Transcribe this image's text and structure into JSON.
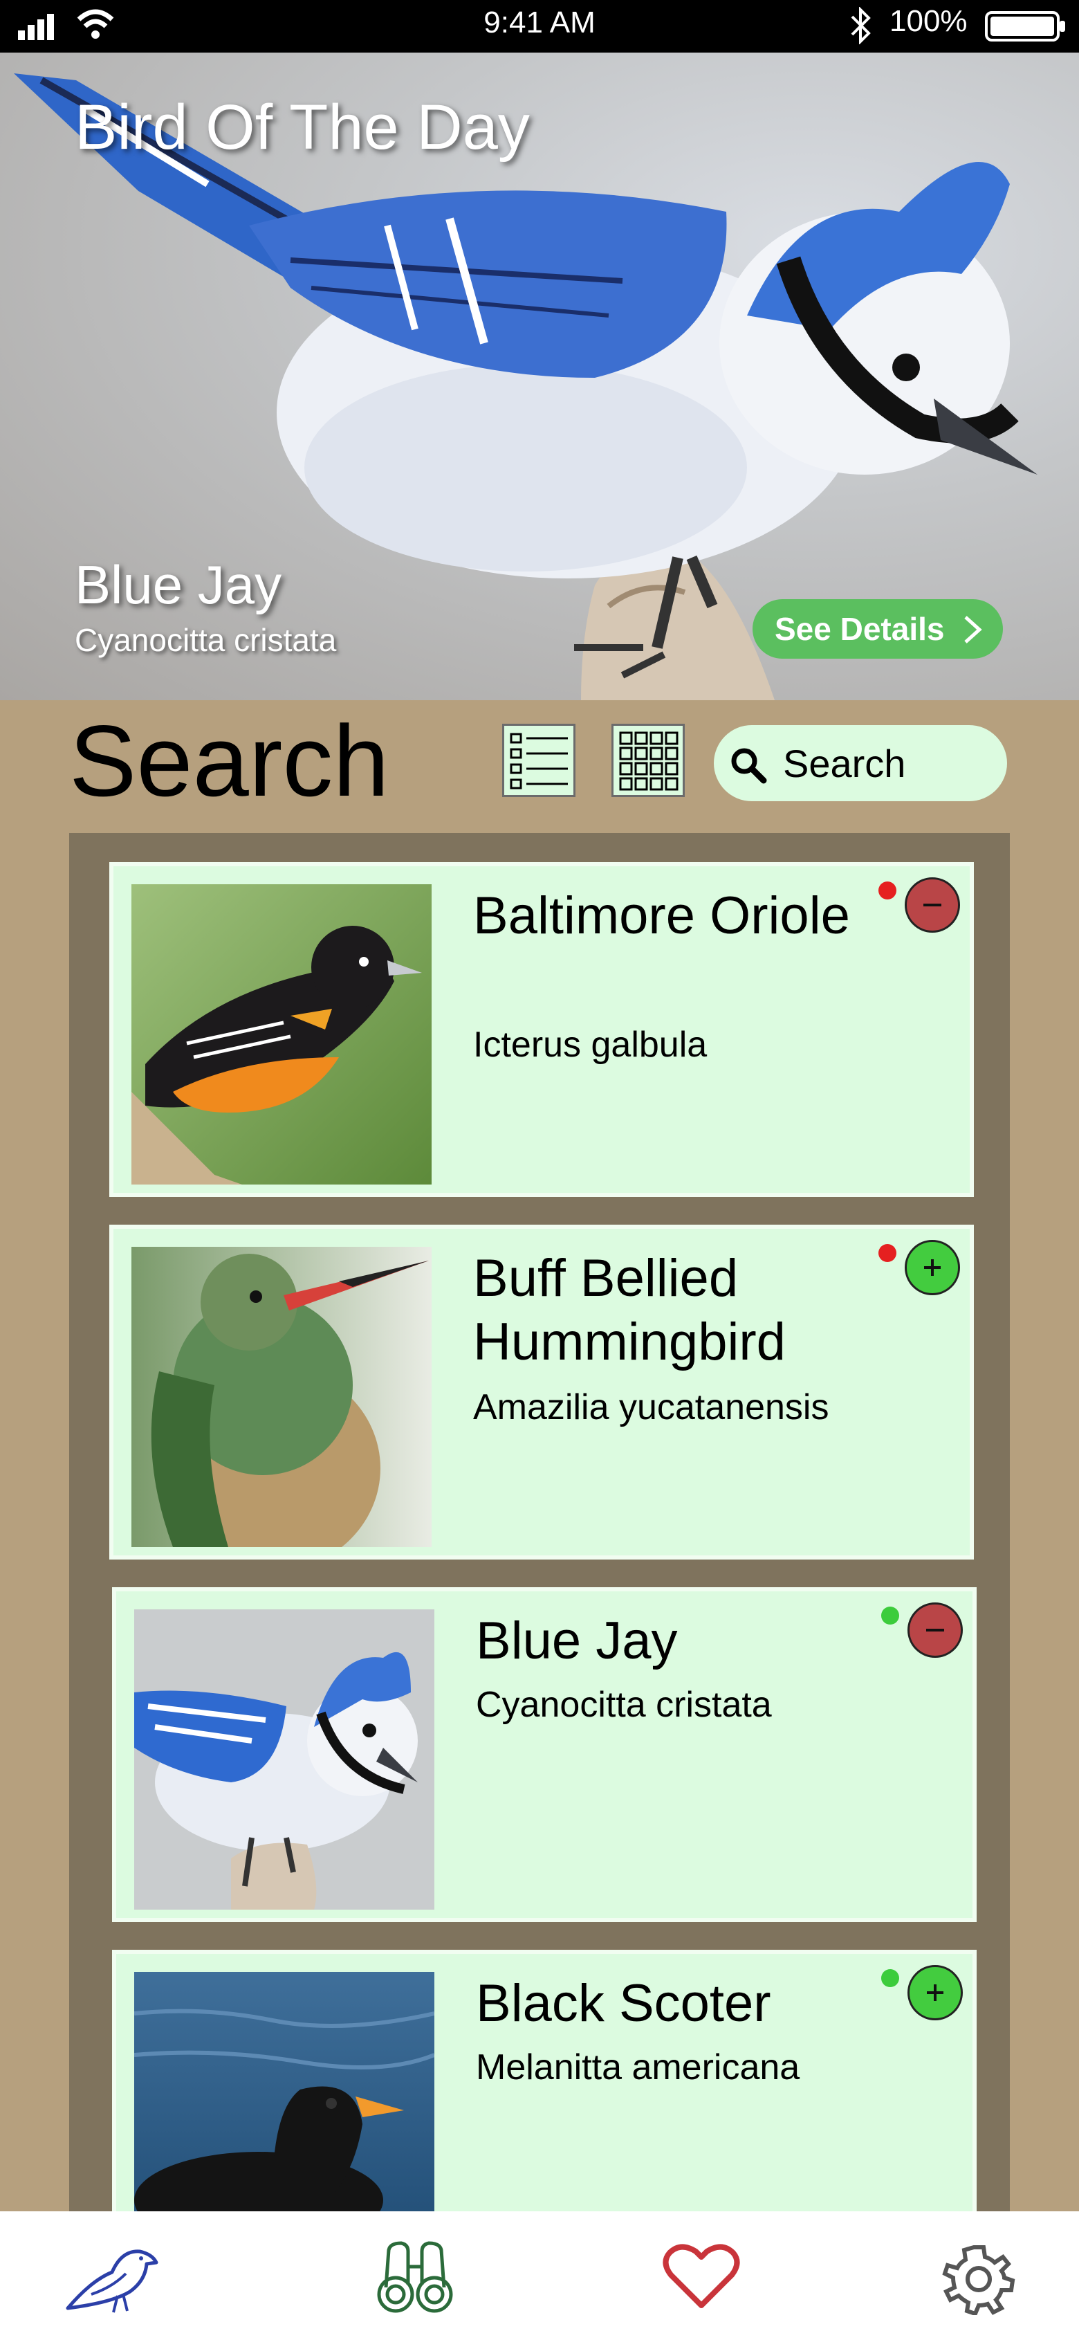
{
  "status_bar": {
    "time": "9:41 AM",
    "battery": "100%"
  },
  "hero": {
    "title": "Bird Of The Day",
    "bird_name": "Blue Jay",
    "scientific_name": "Cyanocitta cristata",
    "details_label": "See Details"
  },
  "search": {
    "title": "Search",
    "placeholder": "Search"
  },
  "birds": [
    {
      "name": "Baltimore Oriole",
      "scientific": "Icterus galbula",
      "status": "red",
      "action": "remove"
    },
    {
      "name": "Buff Bellied Hummingbird",
      "scientific": "Amazilia yucatanensis",
      "status": "red",
      "action": "add"
    },
    {
      "name": "Blue Jay",
      "scientific": "Cyanocitta cristata",
      "status": "green",
      "action": "remove"
    },
    {
      "name": "Black Scoter",
      "scientific": "Melanitta americana",
      "status": "green",
      "action": "add"
    }
  ],
  "colors": {
    "remove": "#b94547",
    "add": "#43cc3f",
    "dot_red": "#e52020",
    "dot_green": "#3ccc3c",
    "card_bg": "#dcfbe0",
    "page_bg": "#b6a07e"
  },
  "nav": [
    {
      "icon": "bird-icon"
    },
    {
      "icon": "binoculars-icon"
    },
    {
      "icon": "heart-icon"
    },
    {
      "icon": "gear-icon"
    }
  ]
}
